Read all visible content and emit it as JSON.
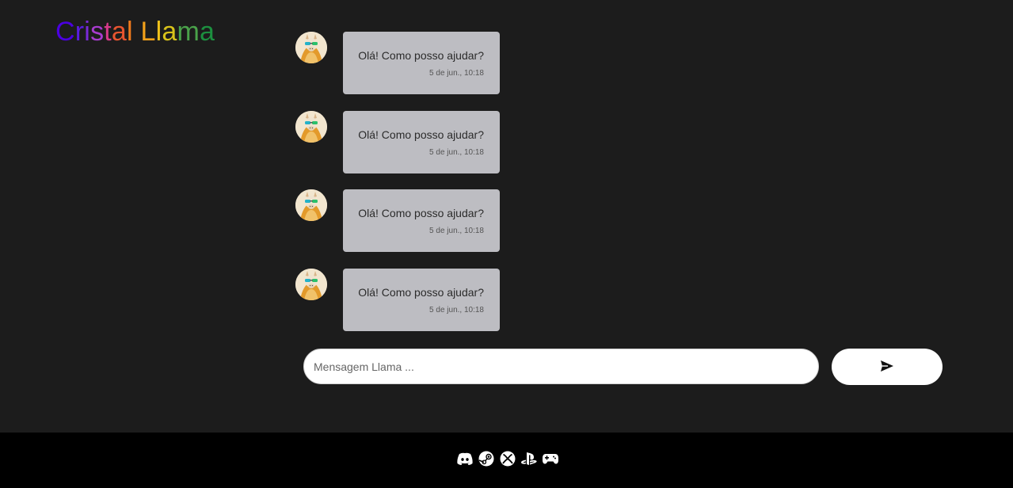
{
  "app": {
    "logo_text": "Cristal Llama",
    "logo_colors": [
      "#4b00e0",
      "#5a1de0",
      "#7a2ad8",
      "#a83ccf",
      "#d63a8a",
      "#e8552f",
      "#f07a1c",
      "#f3a11a",
      "#f1c21b",
      "#d8c21a",
      "#4aa24a",
      "#1c8f3f",
      "#1a7a6a",
      "#1c4fb0"
    ]
  },
  "chat": {
    "messages": [
      {
        "text": "Olá! Como posso ajudar?",
        "time": "5 de jun., 10:18",
        "avatar": "llama-avatar"
      },
      {
        "text": "Olá! Como posso ajudar?",
        "time": "5 de jun., 10:18",
        "avatar": "llama-avatar"
      },
      {
        "text": "Olá! Como posso ajudar?",
        "time": "5 de jun., 10:18",
        "avatar": "llama-avatar"
      },
      {
        "text": "Olá! Como posso ajudar?",
        "time": "5 de jun., 10:18",
        "avatar": "llama-avatar"
      }
    ]
  },
  "composer": {
    "placeholder": "Mensagem Llama ...",
    "value": "",
    "send_icon": "send-icon"
  },
  "footer": {
    "icons": [
      "discord-icon",
      "steam-icon",
      "xbox-icon",
      "playstation-icon",
      "gamepad-icon"
    ]
  },
  "colors": {
    "background": "#1c1c1c",
    "bubble": "#bdbdc2",
    "footer": "#000000",
    "input": "#ffffff"
  }
}
